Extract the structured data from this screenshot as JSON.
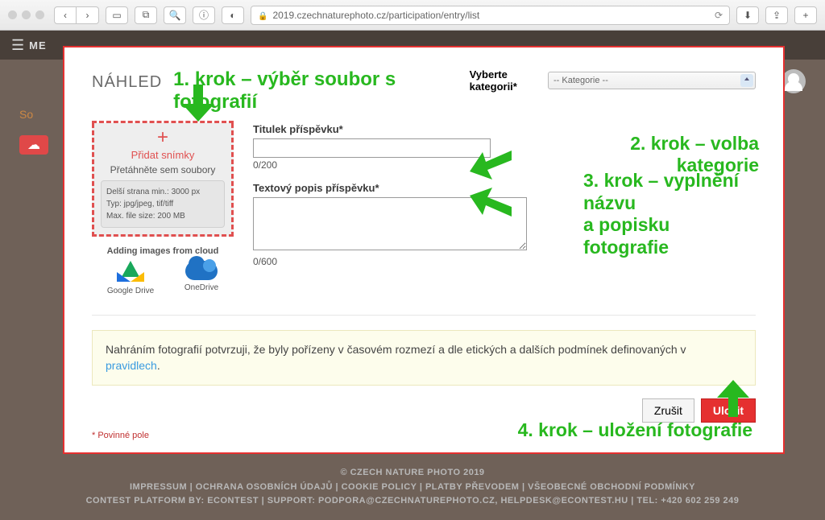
{
  "browser": {
    "url": "2019.czechnaturephoto.cz/participation/entry/list"
  },
  "background": {
    "menu_abbrev": "ME",
    "sidebar_so": "So"
  },
  "footer": {
    "copyright": "© CZECH NATURE PHOTO 2019",
    "links": "IMPRESSUM | OCHRANA OSOBNÍCH ÚDAJŮ | COOKIE POLICY | PLATBY PŘEVODEM | VŠEOBECNÉ OBCHODNÍ PODMÍNKY",
    "support": "CONTEST PLATFORM BY: ECONTEST | SUPPORT: PODPORA@CZECHNATUREPHOTO.CZ, HELPDESK@ECONTEST.HU | TEL: +420 602 259 249"
  },
  "modal": {
    "nahled": "NÁHLED",
    "step1": "1. krok – výběr soubor s fotografií",
    "step2": "2. krok – volba kategorie",
    "step3_line1": "3. krok – vyplnění názvu",
    "step3_line2": "a popisku fotografie",
    "step4": "4. krok – uložení fotografie",
    "category_label": "Vyberte kategorii*",
    "category_placeholder": "-- Kategorie --",
    "upload": {
      "plus": "+",
      "add": "Přidat snímky",
      "drag": "Přetáhněte sem soubory",
      "req1": "Delší strana min.:  3000 px",
      "req2": "Typ:  jpg/jpeg, tif/tiff",
      "req3": "Max. file size:  200 MB"
    },
    "cloud": {
      "title": "Adding images from cloud",
      "gdrive": "Google Drive",
      "onedrive": "OneDrive"
    },
    "title_field": {
      "label": "Titulek příspěvku*",
      "counter": "0/200"
    },
    "desc_field": {
      "label": "Textový popis příspěvku*",
      "counter": "0/600"
    },
    "confirm_text": "Nahráním fotografií potvrzuji, že byly pořízeny v časovém rozmezí a dle etických a dalších podmínek definovaných v ",
    "confirm_link": "pravidlech",
    "confirm_suffix": ".",
    "cancel": "Zrušit",
    "save": "Uložit",
    "required_star": "* ",
    "required_note": "Povinné pole"
  }
}
